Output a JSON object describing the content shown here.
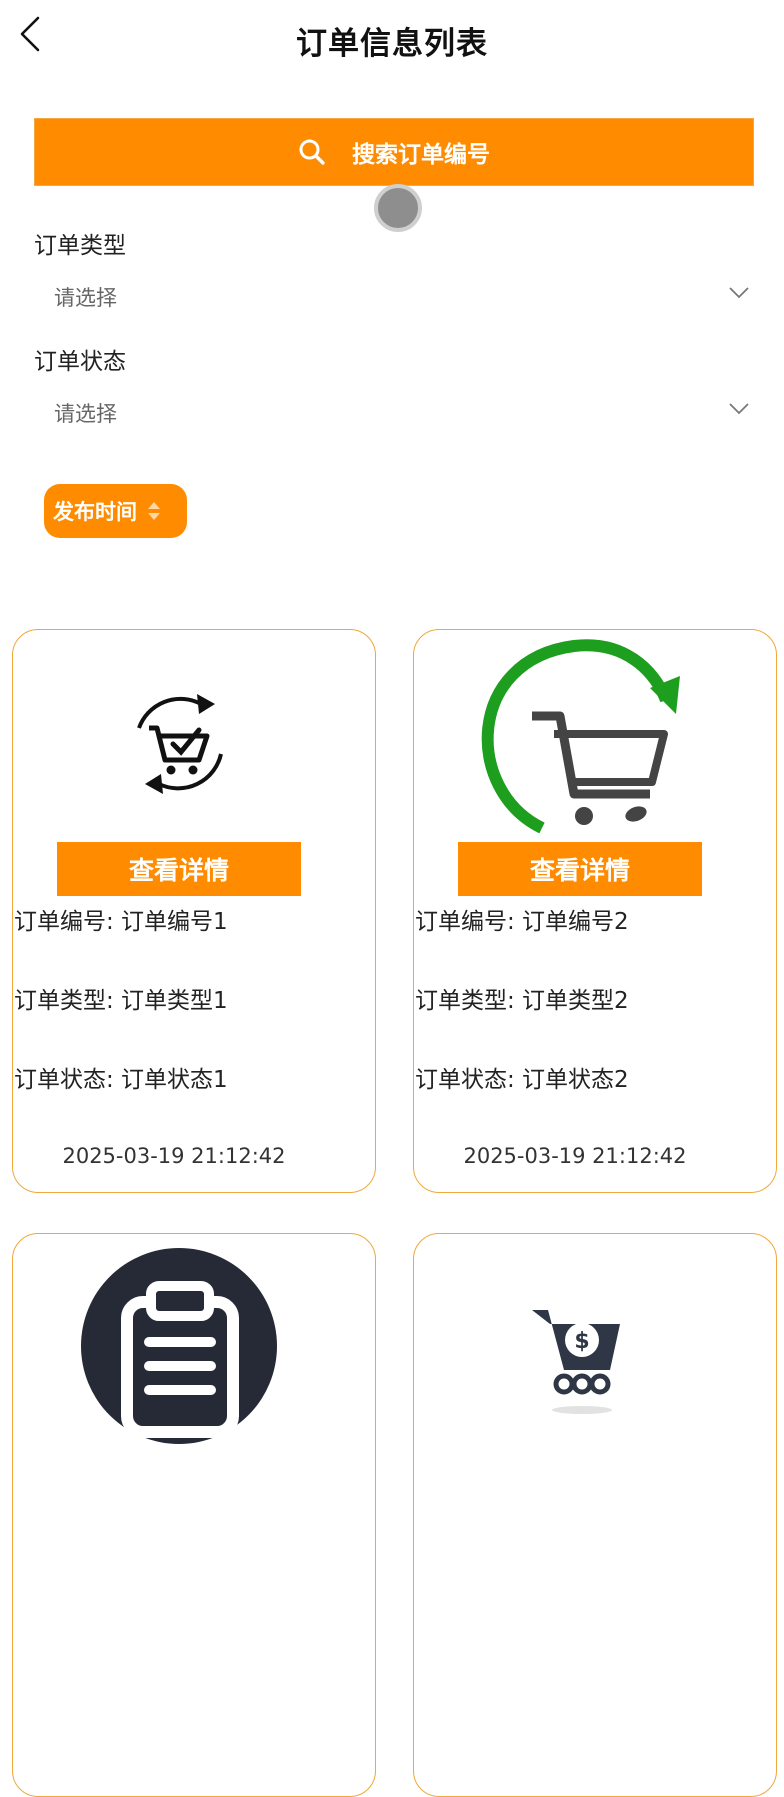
{
  "header": {
    "title": "订单信息列表",
    "back_icon": "chevron-left-icon"
  },
  "search": {
    "label": "搜索订单编号",
    "icon": "search-icon",
    "color": "#ff8c00"
  },
  "filters": [
    {
      "label": "订单类型",
      "placeholder": "请选择"
    },
    {
      "label": "订单状态",
      "placeholder": "请选择"
    }
  ],
  "sort": {
    "label": "发布时间"
  },
  "orders": [
    {
      "image": "cart-check-cycle-icon",
      "detail_label": "查看详情",
      "number_line": "订单编号: 订单编号1",
      "type_line": "订单类型: 订单类型1",
      "status_line": "订单状态: 订单状态1",
      "time": "2025-03-19 21:12:42"
    },
    {
      "image": "cart-green-arrow-icon",
      "detail_label": "查看详情",
      "number_line": "订单编号: 订单编号2",
      "type_line": "订单类型: 订单类型2",
      "status_line": "订单状态: 订单状态2",
      "time": "2025-03-19 21:12:42"
    },
    {
      "image": "clipboard-icon"
    },
    {
      "image": "cart-dollar-icon"
    }
  ],
  "colors": {
    "accent": "#ff8c00",
    "card_border": "#f0a83a"
  }
}
